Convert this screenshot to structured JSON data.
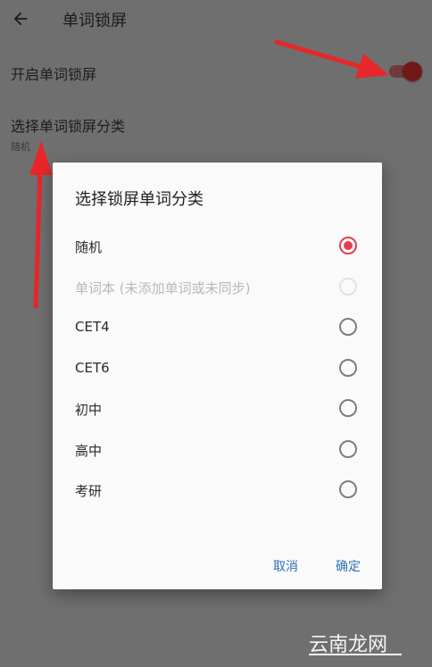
{
  "appbar": {
    "title": "单词锁屏"
  },
  "settings": {
    "enable_label": "开启单词锁屏",
    "enable_on": true,
    "category_label": "选择单词锁屏分类",
    "category_value": "随机"
  },
  "dialog": {
    "title": "选择锁屏单词分类",
    "options": [
      {
        "label": "随机",
        "selected": true,
        "enabled": true
      },
      {
        "label": "单词本 (未添加单词或未同步)",
        "selected": false,
        "enabled": false
      },
      {
        "label": "CET4",
        "selected": false,
        "enabled": true
      },
      {
        "label": "CET6",
        "selected": false,
        "enabled": true
      },
      {
        "label": "初中",
        "selected": false,
        "enabled": true
      },
      {
        "label": "高中",
        "selected": false,
        "enabled": true
      },
      {
        "label": "考研",
        "selected": false,
        "enabled": true
      }
    ],
    "cancel_label": "取消",
    "confirm_label": "确定"
  },
  "watermark": {
    "text": "云南龙网"
  },
  "colors": {
    "accent": "#e0404c",
    "button_text": "#2f6fb8",
    "annotation_arrow": "#e8262b",
    "toggle_thumb": "#711919"
  }
}
